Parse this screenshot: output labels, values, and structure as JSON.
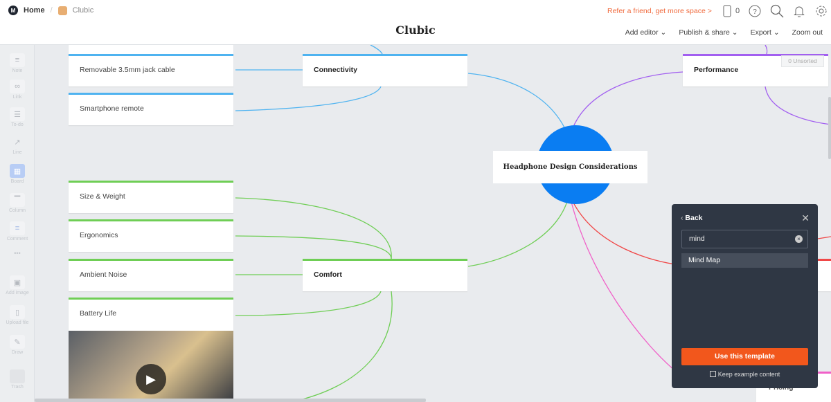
{
  "header": {
    "home": "Home",
    "board": "Clubic",
    "title": "Clubic",
    "refer": "Refer a friend, get more space >",
    "device_count": "0",
    "menu": [
      "Add editor ⌄",
      "Publish & share ⌄",
      "Export ⌄",
      "Zoom out"
    ]
  },
  "sidebar": {
    "tools": [
      "Note",
      "Link",
      "To-do",
      "Line",
      "Board",
      "Column",
      "Comment",
      "•••",
      "Add image",
      "Upload file",
      "Draw",
      "Trash"
    ]
  },
  "canvas": {
    "center": "Headphone Design Considerations",
    "connectivity": {
      "title": "Connectivity",
      "items": [
        "Removable 3.5mm jack cable",
        "Smartphone remote"
      ]
    },
    "comfort": {
      "title": "Comfort",
      "items": [
        "Size & Weight",
        "Ergonomics",
        "Ambient Noise",
        "Battery Life"
      ]
    },
    "performance": {
      "title": "Performance"
    },
    "pricing": "Pricing",
    "unsorted": "0 Unsorted"
  },
  "panel": {
    "back": "Back",
    "search_value": "mind",
    "result": "Mind Map",
    "use_button": "Use this template",
    "keep_label": "Keep example content"
  },
  "colors": {
    "connectivity": "#4fb3f0",
    "comfort": "#6fce55",
    "performance": "#a25ff0",
    "center": "#0a7df2",
    "accent": "#f2571c"
  }
}
